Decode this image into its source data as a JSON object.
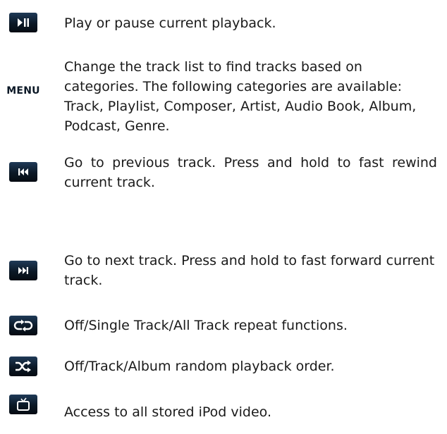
{
  "controls": [
    {
      "icon": "play-pause-icon",
      "description": "Play or pause current playback."
    },
    {
      "icon": "menu-icon",
      "icon_label": "MENU",
      "description": "Change the track list to find tracks based on categories. The following categories are available: Track, Playlist, Composer, Artist, Audio Book, Album, Podcast, Genre."
    },
    {
      "icon": "previous-track-icon",
      "description": "Go to previous track. Press and hold to fast rewind current track."
    },
    {
      "icon": "next-track-icon",
      "description": "Go to next track. Press and hold to fast forward current track."
    },
    {
      "icon": "repeat-icon",
      "description": "Off/Single Track/All Track repeat functions."
    },
    {
      "icon": "shuffle-icon",
      "description": "Off/Track/Album random playback order."
    },
    {
      "icon": "video-icon",
      "description": "Access to all stored iPod video."
    }
  ],
  "colors": {
    "icon_background": "#0b1826",
    "icon_glyph": "#ffffff",
    "text": "#1a1a1a"
  }
}
